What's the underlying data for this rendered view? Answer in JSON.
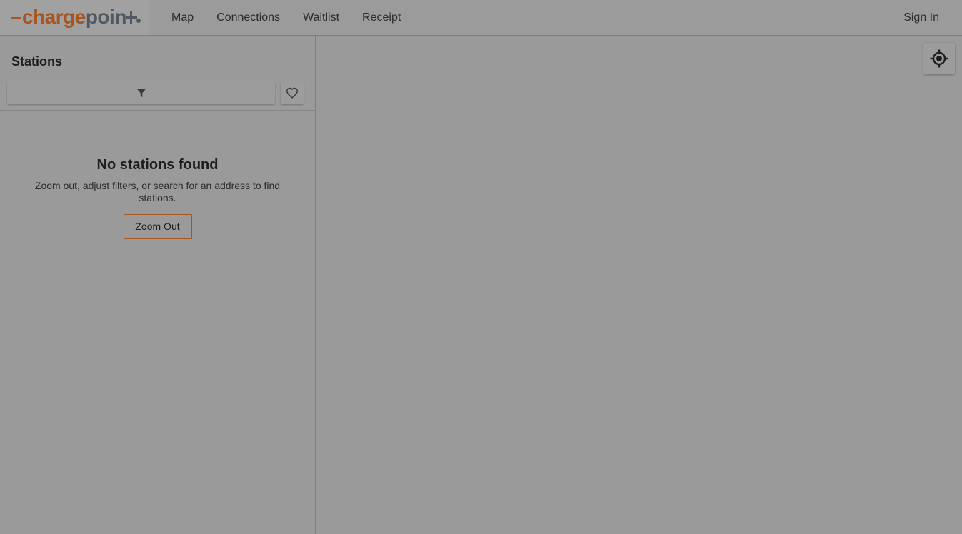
{
  "header": {
    "logo": {
      "text_orange": "charge",
      "text_gray": "poin",
      "brand_orange": "#a85521",
      "brand_gray": "#515a64"
    },
    "nav": [
      {
        "label": "Map"
      },
      {
        "label": "Connections"
      },
      {
        "label": "Waitlist"
      },
      {
        "label": "Receipt"
      }
    ],
    "signin_label": "Sign In"
  },
  "sidebar": {
    "title": "Stations",
    "filter_icon": "filter-icon",
    "favorites_icon": "heart-icon",
    "empty_state": {
      "title": "No stations found",
      "message": "Zoom out, adjust filters, or search for an address to find stations.",
      "button_label": "Zoom Out"
    }
  },
  "map": {
    "locate_icon": "my-location-icon"
  },
  "colors": {
    "accent": "#a85521",
    "overlay_gray": "#9a9a9a"
  }
}
